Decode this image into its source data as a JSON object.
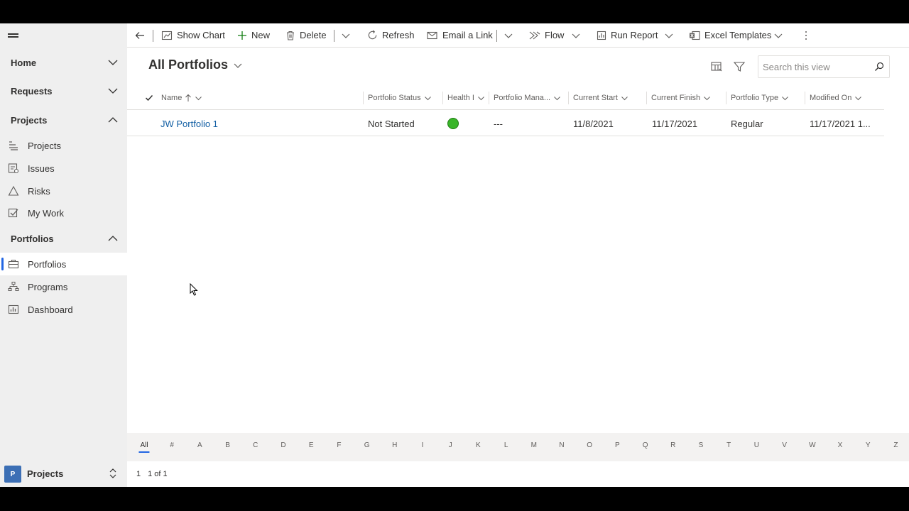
{
  "sidebar": {
    "groups": [
      {
        "label": "Home"
      },
      {
        "label": "Requests"
      },
      {
        "label": "Projects"
      },
      {
        "label": "Portfolios"
      }
    ],
    "project_items": [
      {
        "label": "Projects"
      },
      {
        "label": "Issues"
      },
      {
        "label": "Risks"
      },
      {
        "label": "My Work"
      }
    ],
    "portfolio_items": [
      {
        "label": "Portfolios"
      },
      {
        "label": "Programs"
      },
      {
        "label": "Dashboard"
      }
    ],
    "area": {
      "badge": "P",
      "label": "Projects"
    }
  },
  "commandbar": {
    "show_chart": "Show Chart",
    "new": "New",
    "delete": "Delete",
    "refresh": "Refresh",
    "email_link": "Email a Link",
    "flow": "Flow",
    "run_report": "Run Report",
    "excel_templates": "Excel Templates"
  },
  "view": {
    "title": "All Portfolios",
    "search_placeholder": "Search this view"
  },
  "grid": {
    "columns": [
      "Name",
      "Portfolio Status",
      "Health I",
      "Portfolio Mana...",
      "Current Start",
      "Current Finish",
      "Portfolio Type",
      "Modified On"
    ],
    "rows": [
      {
        "name": "JW Portfolio 1",
        "status": "Not Started",
        "health_color": "#39b529",
        "manager": "---",
        "start": "11/8/2021",
        "finish": "11/17/2021",
        "type": "Regular",
        "modified": "11/17/2021 1..."
      }
    ]
  },
  "jumpbar": [
    "All",
    "#",
    "A",
    "B",
    "C",
    "D",
    "E",
    "F",
    "G",
    "H",
    "I",
    "J",
    "K",
    "L",
    "M",
    "N",
    "O",
    "P",
    "Q",
    "R",
    "S",
    "T",
    "U",
    "V",
    "W",
    "X",
    "Y",
    "Z"
  ],
  "pager": {
    "page": "1",
    "range": "1 of 1"
  },
  "colors": {
    "accent": "#2266e3",
    "link": "#115ea3",
    "sidebar_bg": "#efefef"
  }
}
